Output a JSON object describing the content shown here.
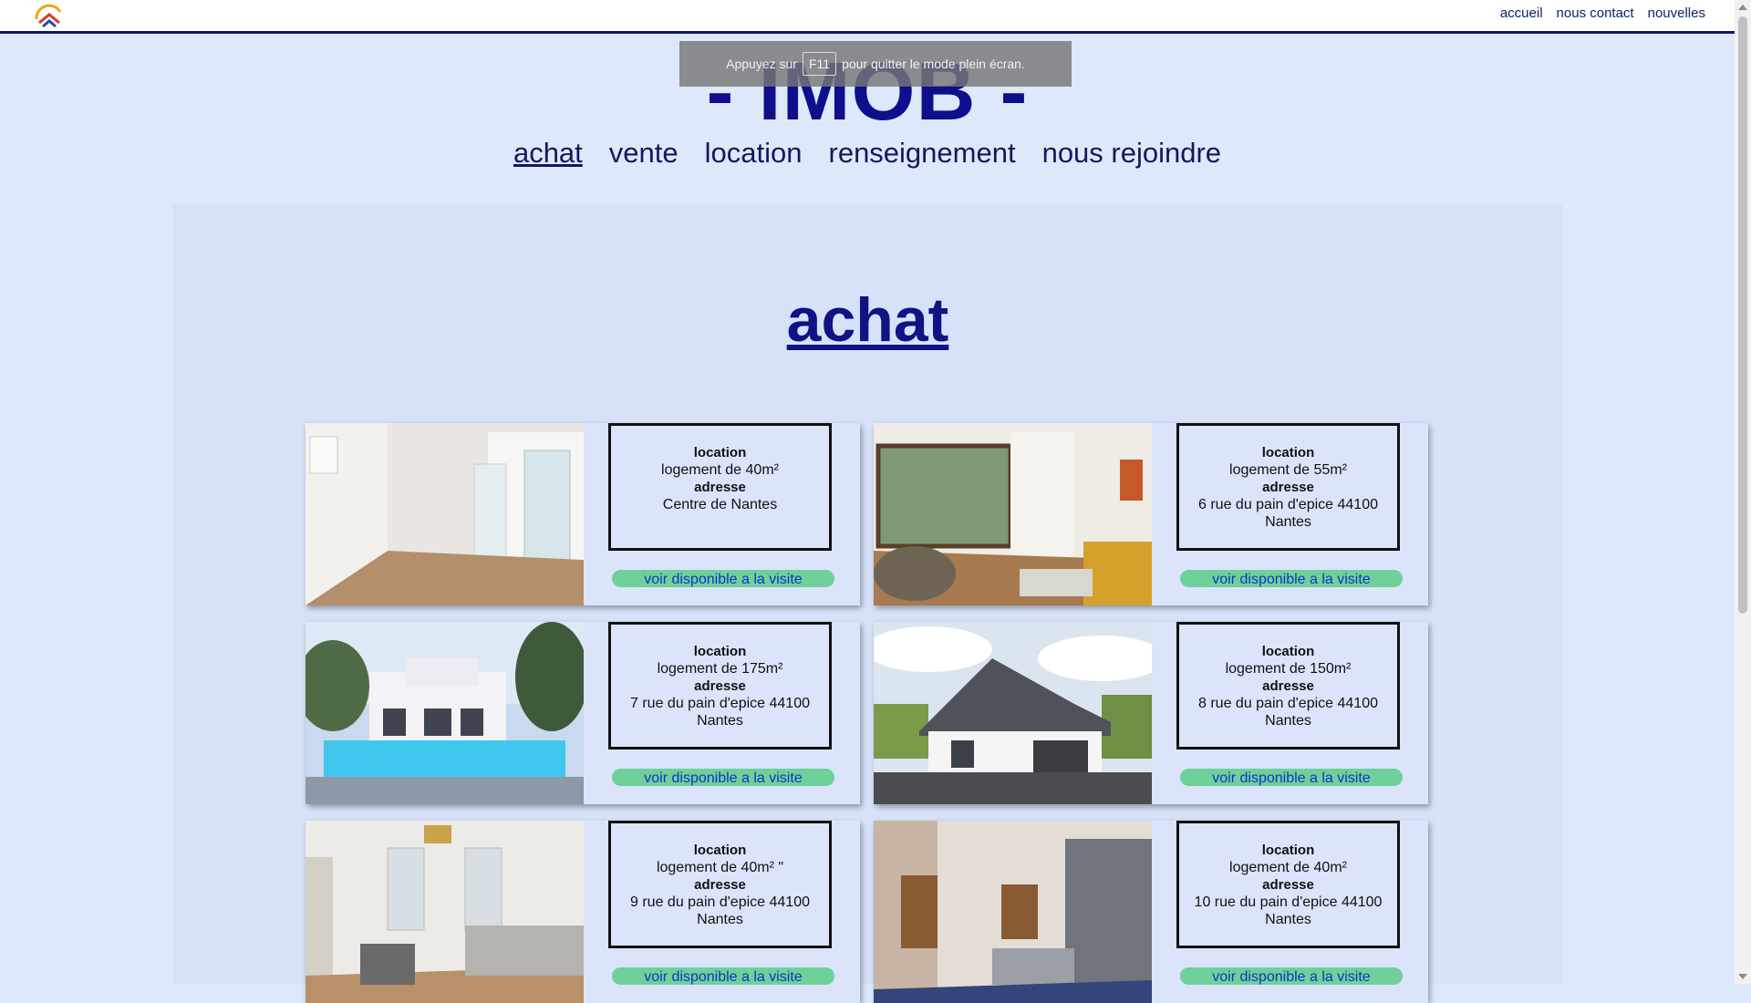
{
  "topnav": {
    "links": [
      "accueil",
      "nous contact",
      "nouvelles"
    ]
  },
  "brand": "- IMOB -",
  "fullscreen_toast": {
    "before": "Appuyez sur",
    "key": "F11",
    "after": "pour quitter le mode plein écran."
  },
  "mainnav": {
    "links": [
      "achat",
      "vente",
      "location",
      "renseignement",
      "nous rejoindre"
    ],
    "active": "achat"
  },
  "section_title": "achat",
  "listings": [
    {
      "type": "location",
      "size": "logement de 40m²",
      "address_label": "adresse",
      "address": "Centre de Nantes",
      "button": "voir disponible a la visite",
      "photo": "interior-empty-room"
    },
    {
      "type": "location",
      "size": "logement de 55m²",
      "address_label": "adresse",
      "address": "6 rue du pain d'epice 44100 Nantes",
      "button": "voir disponible a la visite",
      "photo": "living-room-chairs"
    },
    {
      "type": "location",
      "size": "logement de 175m²",
      "address_label": "adresse",
      "address": "7 rue du pain d'epice 44100 Nantes",
      "button": "voir disponible a la visite",
      "photo": "villa-pool"
    },
    {
      "type": "location",
      "size": "logement de 150m²",
      "address_label": "adresse",
      "address": "8 rue du pain d'epice 44100 Nantes",
      "button": "voir disponible a la visite",
      "photo": "house-garage"
    },
    {
      "type": "location",
      "size": "logement de 40m² \"",
      "address_label": "adresse",
      "address": "9 rue du pain d'epice 44100 Nantes",
      "button": "voir disponible a la visite",
      "photo": "living-room-sofa"
    },
    {
      "type": "location",
      "size": "logement de 40m²",
      "address_label": "adresse",
      "address": "10 rue du pain d'epice 44100 Nantes",
      "button": "voir disponible a la visite",
      "photo": "kitchen-brick"
    }
  ],
  "colors": {
    "brand": "#0d0f8c",
    "nav": "#101a5c",
    "button_bg": "#6fd09a",
    "button_text": "#1234c8",
    "page_bg": "#dde8fb"
  }
}
